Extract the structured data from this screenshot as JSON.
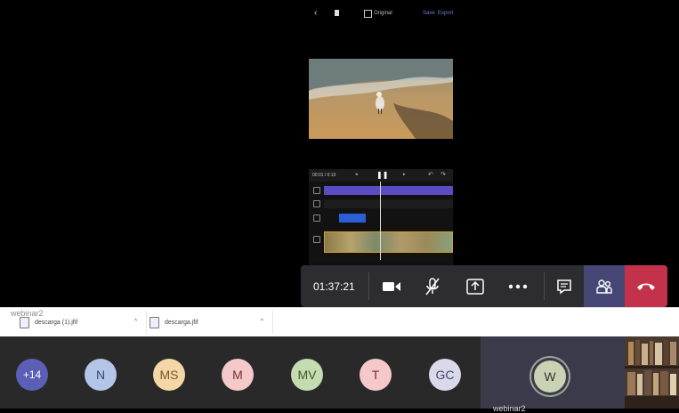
{
  "call": {
    "timer": "01:37:21",
    "controls": [
      "camera",
      "mute",
      "share",
      "more",
      "chat",
      "participants",
      "hang-up"
    ],
    "hangup_color": "#c4314b",
    "active_color": "#464775"
  },
  "editor": {
    "aspect_label": "Original",
    "save_label": "Save",
    "export_label": "Export",
    "timecode": "00:01 / 0:15"
  },
  "downloads": {
    "overlay_name": "webinar2",
    "items": [
      {
        "name": "descarga (1).jfif"
      },
      {
        "name": "descarga.jfif"
      }
    ]
  },
  "participants": {
    "overflow": "+14",
    "avatars": [
      {
        "initials": "N",
        "color": "#b4c6e8"
      },
      {
        "initials": "MS",
        "color": "#f4d6a8"
      },
      {
        "initials": "M",
        "color": "#f3c9c9"
      },
      {
        "initials": "MV",
        "color": "#c5dbb0"
      },
      {
        "initials": "T",
        "color": "#f5c9c9"
      },
      {
        "initials": "GC",
        "color": "#d9d9ea"
      }
    ],
    "active_tile": {
      "initials": "W",
      "name": "webinar2"
    }
  }
}
